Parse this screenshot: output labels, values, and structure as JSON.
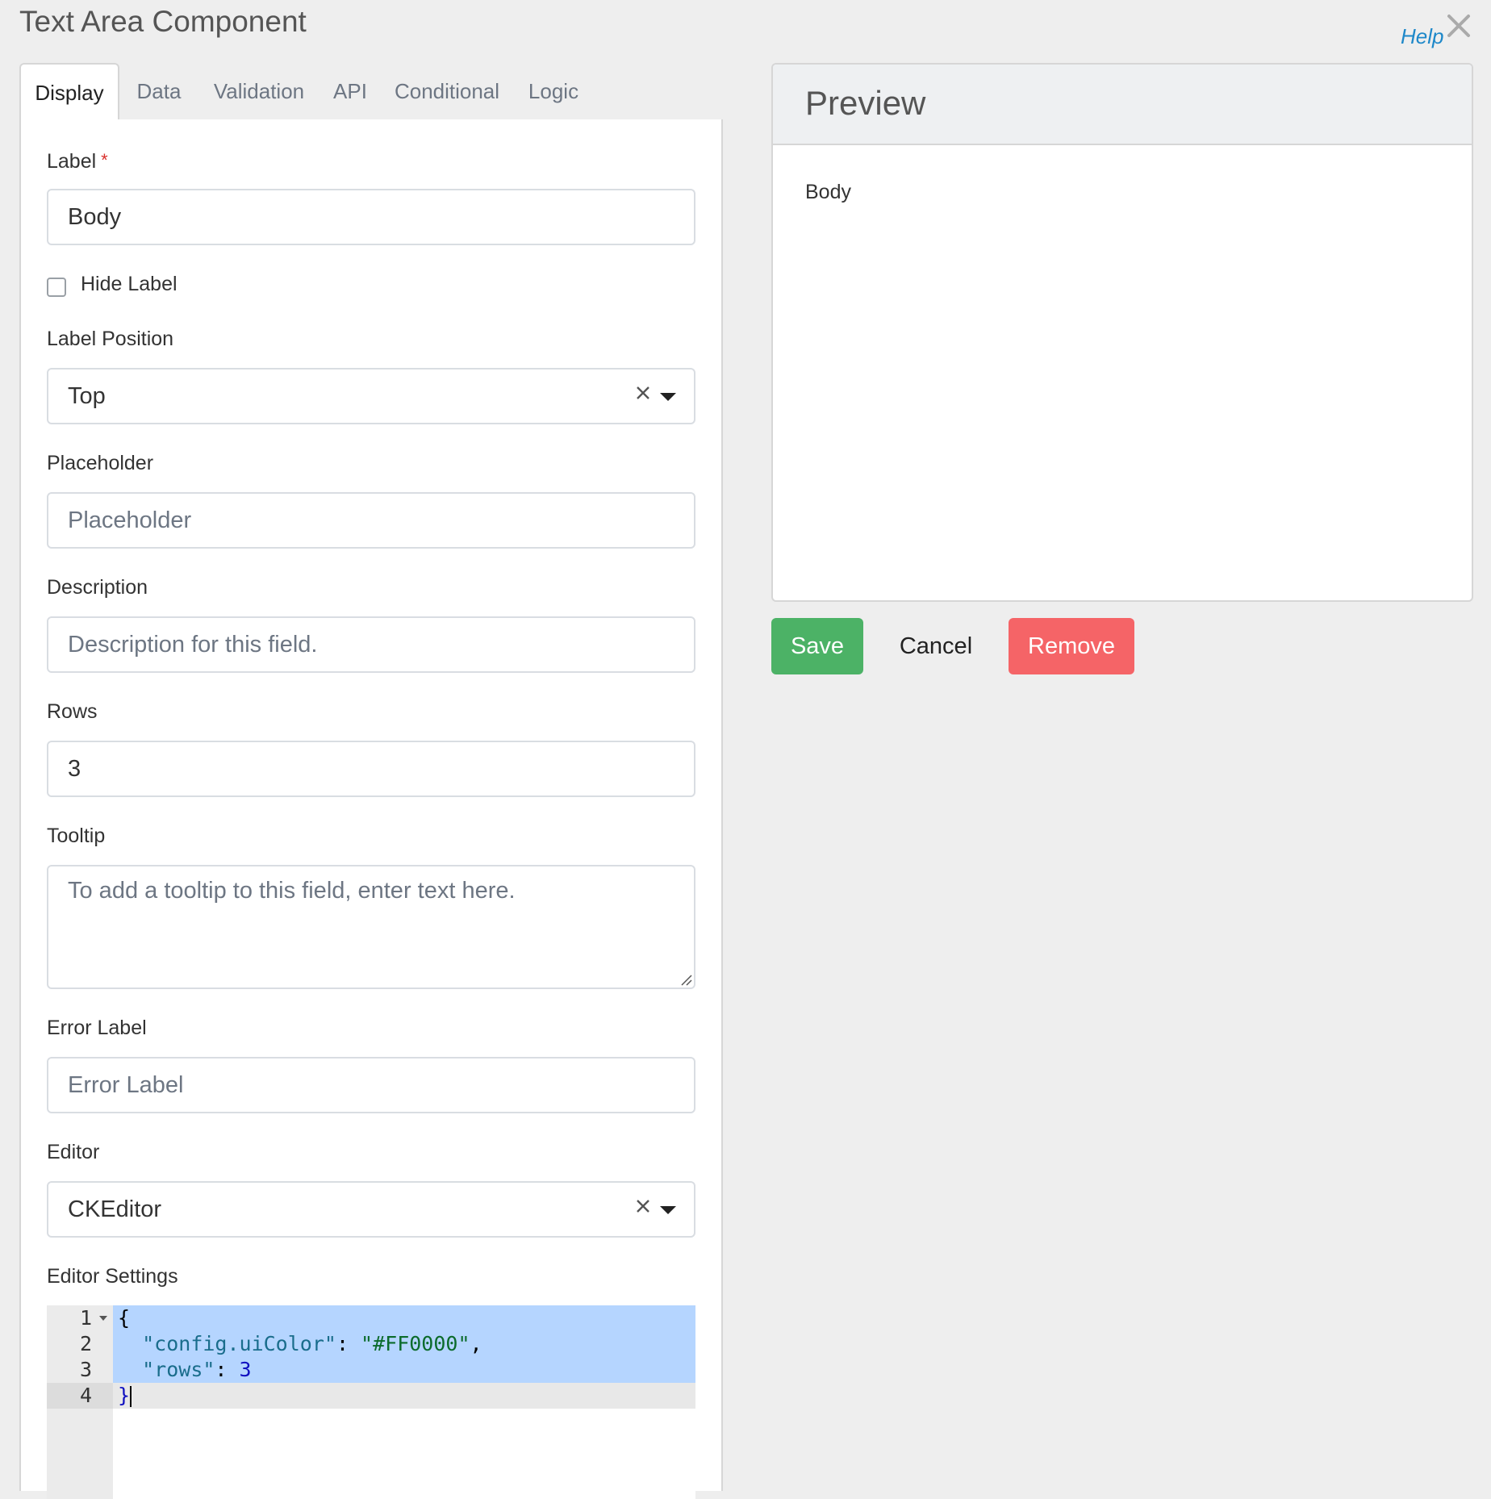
{
  "dialog": {
    "title": "Text Area Component",
    "help_label": "Help"
  },
  "tabs": [
    {
      "label": "Display",
      "active": true
    },
    {
      "label": "Data"
    },
    {
      "label": "Validation"
    },
    {
      "label": "API"
    },
    {
      "label": "Conditional"
    },
    {
      "label": "Logic"
    }
  ],
  "form": {
    "label": {
      "caption": "Label",
      "required_marker": "*",
      "value": "Body"
    },
    "hide_label": {
      "caption": "Hide Label",
      "checked": false
    },
    "label_position": {
      "caption": "Label Position",
      "value": "Top"
    },
    "placeholder": {
      "caption": "Placeholder",
      "placeholder": "Placeholder"
    },
    "description": {
      "caption": "Description",
      "placeholder": "Description for this field."
    },
    "rows": {
      "caption": "Rows",
      "value": "3"
    },
    "tooltip": {
      "caption": "Tooltip",
      "placeholder": "To add a tooltip to this field, enter text here."
    },
    "error_label": {
      "caption": "Error Label",
      "placeholder": "Error Label"
    },
    "editor": {
      "caption": "Editor",
      "value": "CKEditor"
    },
    "editor_settings": {
      "caption": "Editor Settings",
      "lines": [
        {
          "num": "1",
          "text": "{"
        },
        {
          "num": "2",
          "key": "\"config.uiColor\"",
          "sep": ": ",
          "str": "\"#FF0000\"",
          "tail": ","
        },
        {
          "num": "3",
          "key": "\"rows\"",
          "sep": ": ",
          "num_val": "3"
        },
        {
          "num": "4",
          "text": "}"
        }
      ]
    }
  },
  "preview": {
    "title": "Preview",
    "field_label": "Body"
  },
  "actions": {
    "save": "Save",
    "cancel": "Cancel",
    "remove": "Remove"
  },
  "colors": {
    "save": "#4cb266",
    "remove": "#f56467",
    "help_link": "#1e88c9",
    "selection": "#b5d5ff"
  }
}
